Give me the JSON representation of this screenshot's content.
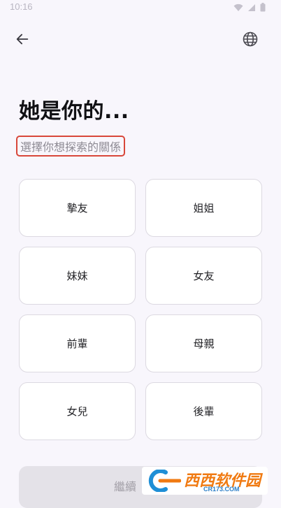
{
  "status_bar": {
    "time": "10:16",
    "icons": [
      "wifi-icon",
      "signal-icon",
      "battery-icon"
    ]
  },
  "toolbar": {
    "back_icon": "arrow-left-icon",
    "language_icon": "globe-icon"
  },
  "heading": {
    "title": "她是你的...",
    "subtitle": "選擇你想探索的關係"
  },
  "options": [
    {
      "label": "摯友"
    },
    {
      "label": "姐姐"
    },
    {
      "label": "妹妹"
    },
    {
      "label": "女友"
    },
    {
      "label": "前輩"
    },
    {
      "label": "母親"
    },
    {
      "label": "女兒"
    },
    {
      "label": "後輩"
    }
  ],
  "continue_button": {
    "label": "繼續"
  },
  "watermark": {
    "title": "西西软件园",
    "subtitle": "CR173.COM"
  },
  "colors": {
    "background": "#f8f6fc",
    "highlight_border": "#d8473a",
    "card_border": "#dcd9e1",
    "button_disabled": "#e4e2e8"
  }
}
